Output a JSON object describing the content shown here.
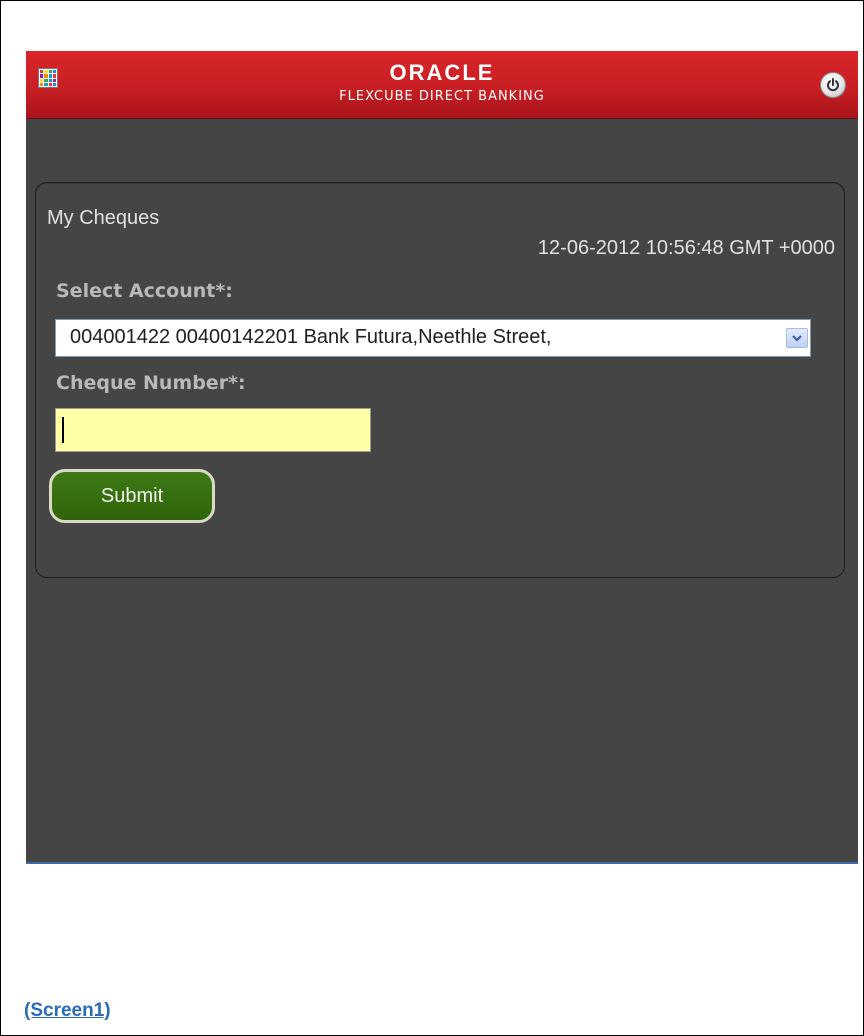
{
  "header": {
    "brand_logo": "ORACLE",
    "brand_subtitle": "FLEXCUBE DIRECT BANKING",
    "menu_icon": "app-grid-icon",
    "power_icon": "power-icon",
    "menu_icon_colors": [
      "#e53935",
      "#fdd835",
      "#43a047",
      "#1e88e5",
      "#8e24aa",
      "#fb8c00",
      "#00acc1",
      "#e53935",
      "#fdd835",
      "#43a047",
      "#1e88e5",
      "#8e24aa",
      "#fb8c00",
      "#00acc1",
      "#e53935",
      "#1e88e5"
    ]
  },
  "page": {
    "title": "My Cheques",
    "timestamp": "12-06-2012 10:56:48 GMT +0000"
  },
  "form": {
    "account_label": "Select Account*:",
    "account_selected": "004001422 00400142201 Bank Futura,Neethle Street,",
    "cheque_label": "Cheque Number*:",
    "cheque_value": "",
    "submit_label": "Submit"
  },
  "caption": "(Screen1)",
  "colors": {
    "header_red": "#c81f24",
    "background": "#454545",
    "input_yellow": "#ffffa6",
    "submit_green": "#2f6409",
    "caption_blue": "#2a6bb5"
  }
}
